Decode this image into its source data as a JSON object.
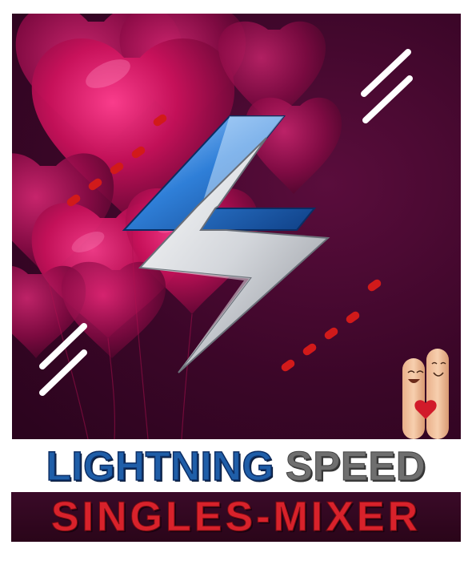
{
  "title": {
    "word1": "LIGHTNING",
    "word2": "SPEED",
    "subtitle": "SINGLES-MIXER"
  },
  "colors": {
    "background_dark": "#3b0628",
    "heart_pink": "#d4125e",
    "lightning_blue": "#2f7fd8",
    "lightning_silver": "#d9dde2",
    "title_blue": "#1f5ea8",
    "title_gray": "#6f6f6f",
    "subtitle_red": "#d8222b",
    "dots_red": "#d11a1a"
  },
  "icons": {
    "logo": "lightning-bolt-logo",
    "balloons": "heart-balloons",
    "mascot": "finger-couple"
  }
}
